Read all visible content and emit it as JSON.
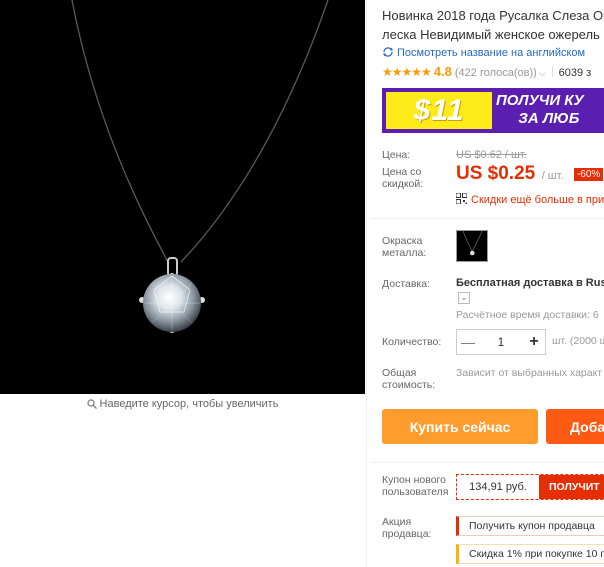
{
  "gallery": {
    "zoom_hint": "Наведите курсор, чтобы увеличить"
  },
  "product": {
    "title_line1": "Новинка 2018 года Русалка Слеза Оз",
    "title_line2": "леска Невидимый женское ожерель",
    "translate_link": "Посмотреть название на английском",
    "rating": "4.8",
    "votes": "(422 голоса(ов))",
    "orders": "6039 з"
  },
  "banner": {
    "amount": "$11",
    "line1": "ПОЛУЧИ КУ",
    "line2": "ЗА ЛЮБ"
  },
  "price": {
    "label": "Цена:",
    "old": "US $0.62 / шт.",
    "discount_label_1": "Цена со",
    "discount_label_2": "скидкой:",
    "current": "US $0.25",
    "unit": "/ шт.",
    "discount_pct": "-60%",
    "bulk_note": "Скидки ещё больше в при"
  },
  "color": {
    "label_1": "Окраска",
    "label_2": "металла:"
  },
  "shipping": {
    "label": "Доставка:",
    "main": "Бесплатная доставка в Russ",
    "time": "Расчётное время доставки: 6"
  },
  "quantity": {
    "label": "Количество:",
    "value": "1",
    "note": "шт. (2000 ш"
  },
  "total": {
    "label_1": "Общая",
    "label_2": "стоимость:",
    "note": "Зависит от выбранных характ"
  },
  "actions": {
    "buy_now": "Купить сейчас",
    "add_cart": "Доба"
  },
  "coupon": {
    "label_1": "Купон нового",
    "label_2": "пользователя",
    "amount": "134,91 руб.",
    "get": "ПОЛУЧИТ"
  },
  "promo": {
    "label_1": "Акция",
    "label_2": "продавца:",
    "item1": "Получить купон продавца",
    "item2": "Скидка 1% при покупке 10 п"
  },
  "colors": {
    "accent_red": "#e62e04",
    "orange": "#ff9c2e",
    "star": "#ff9900",
    "link_blue": "#2468c8",
    "banner_purple": "#5a1fb0",
    "banner_yellow": "#ffeb1a"
  }
}
